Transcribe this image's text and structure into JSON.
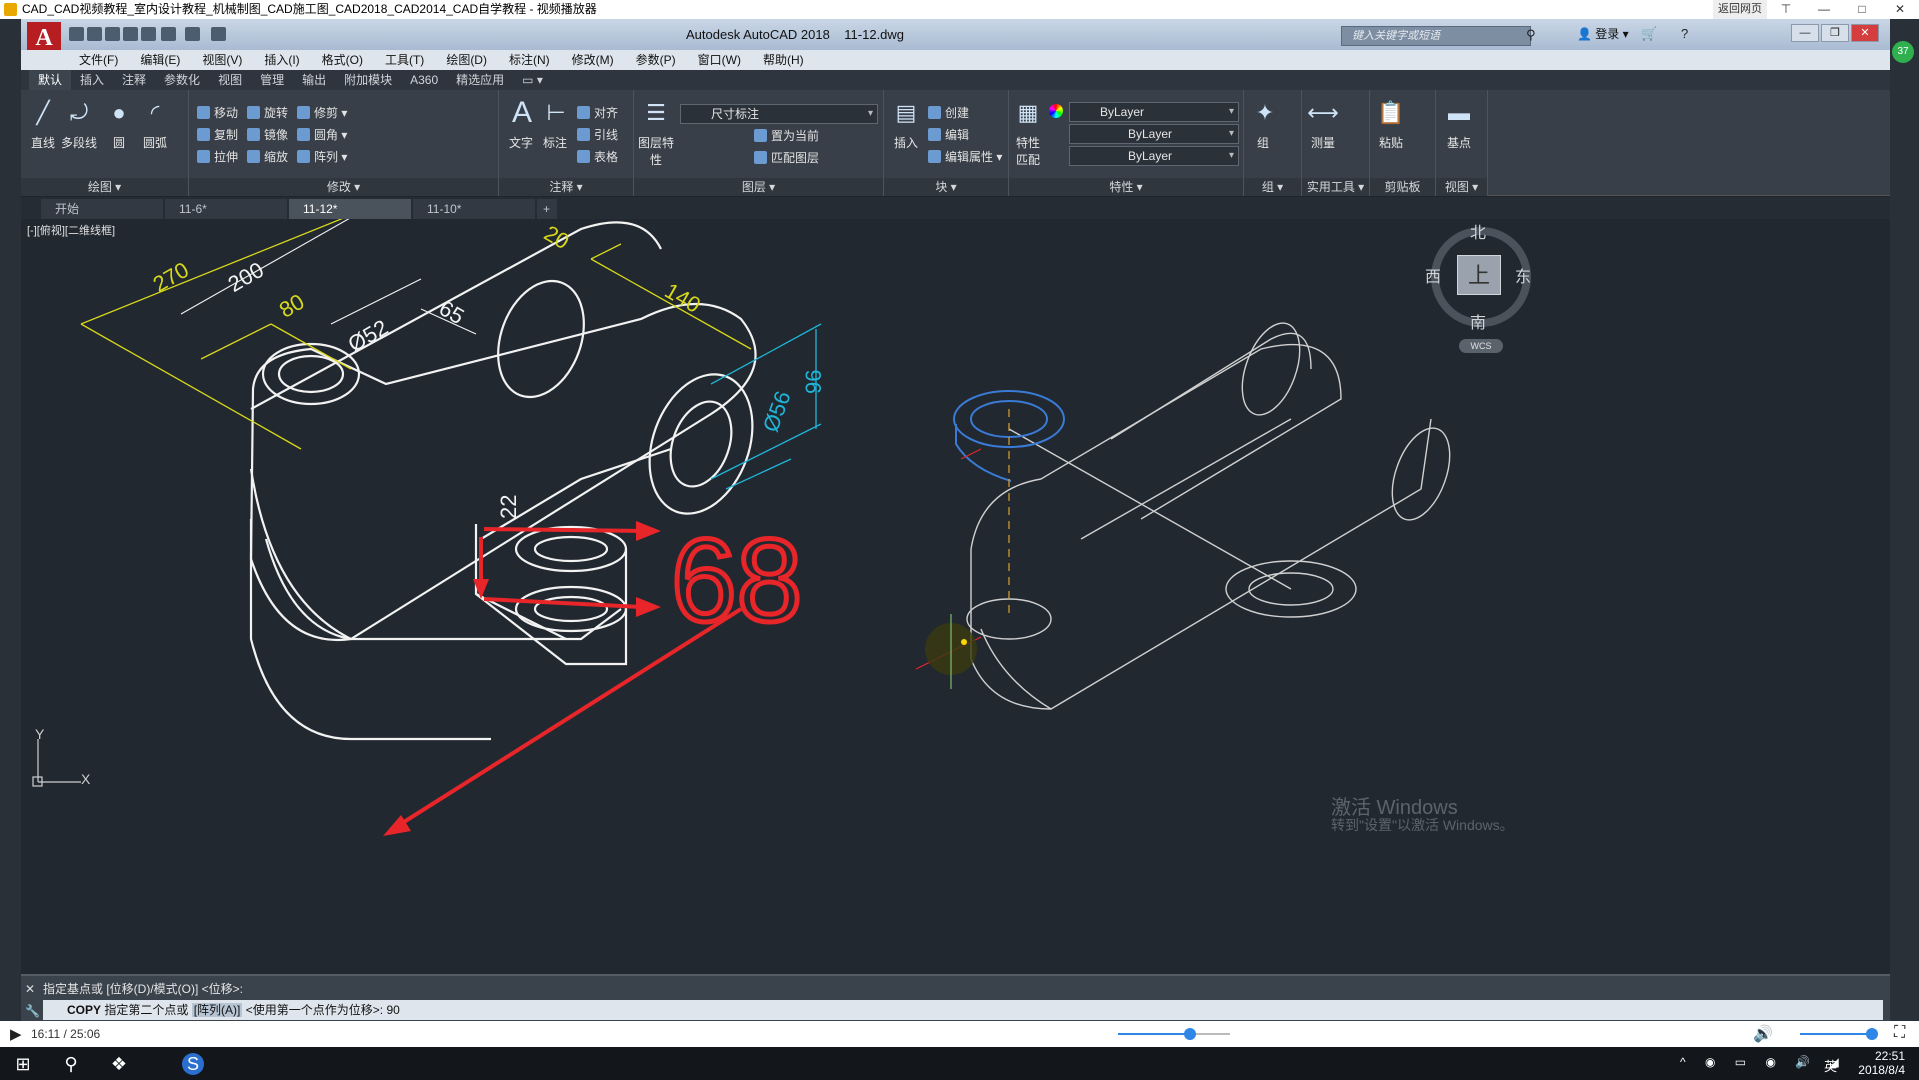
{
  "player": {
    "title": "CAD_CAD视频教程_室内设计教程_机械制图_CAD施工图_CAD2018_CAD2014_CAD自学教程 - 视频播放器",
    "return_label": "返回网页",
    "time": "16:11 / 25:06",
    "progress": 0.645
  },
  "app": {
    "logo": "A",
    "title": "Autodesk AutoCAD 2018",
    "file": "11-12.dwg",
    "search_placeholder": "键入关键字或短语",
    "login": "登录"
  },
  "menu": [
    "文件(F)",
    "编辑(E)",
    "视图(V)",
    "插入(I)",
    "格式(O)",
    "工具(T)",
    "绘图(D)",
    "标注(N)",
    "修改(M)",
    "参数(P)",
    "窗口(W)",
    "帮助(H)"
  ],
  "ribbon_tabs": [
    "默认",
    "插入",
    "注释",
    "参数化",
    "视图",
    "管理",
    "输出",
    "附加模块",
    "A360",
    "精选应用"
  ],
  "ribbon": {
    "draw": {
      "title": "绘图 ▾",
      "line": "直线",
      "polyline": "多段线",
      "circle": "圆",
      "arc": "圆弧"
    },
    "modify": {
      "title": "修改 ▾",
      "move": "移动",
      "rotate": "旋转",
      "trim": "修剪",
      "copy": "复制",
      "mirror": "镜像",
      "fillet": "圆角",
      "stretch": "拉伸",
      "scale": "缩放",
      "array": "阵列"
    },
    "annotation": {
      "title": "注释 ▾",
      "text": "文字",
      "dimension": "标注",
      "align": "对齐",
      "leader": "引线",
      "table": "表格"
    },
    "layers": {
      "title": "图层 ▾",
      "props": "图层特性",
      "current": "尺寸标注",
      "set_current": "置为当前",
      "match": "匹配图层"
    },
    "block": {
      "title": "块 ▾",
      "insert": "插入",
      "create": "创建",
      "edit": "编辑",
      "edit_attr": "编辑属性"
    },
    "properties": {
      "title": "特性 ▾",
      "match": "特性匹配",
      "color": "ByLayer",
      "linetype": "ByLayer",
      "lineweight": "ByLayer"
    },
    "groups": {
      "title": "组 ▾",
      "group": "组"
    },
    "utilities": {
      "title": "实用工具 ▾",
      "measure": "测量"
    },
    "clipboard": {
      "title": "剪贴板",
      "paste": "粘贴"
    },
    "view": {
      "title": "视图 ▾",
      "base": "基点"
    }
  },
  "doc_tabs": [
    "开始",
    "11-6*",
    "11-12*",
    "11-10*"
  ],
  "viewport_label": "[-][俯视][二维线框]",
  "viewcube": {
    "north": "北",
    "south": "南",
    "east": "东",
    "west": "西",
    "top": "上",
    "wcs": "WCS"
  },
  "ucs": {
    "x": "X",
    "y": "Y"
  },
  "dims": [
    "270",
    "200",
    "80",
    "Ø52",
    "65",
    "20",
    "140",
    "Ø56",
    "96",
    "22"
  ],
  "annotation_number": "68",
  "command": {
    "history": "指定基点或 [位移(D)/模式(O)] <位移>:",
    "name": "COPY",
    "prompt": "指定第二个点或",
    "keyword": "[阵列(A)]",
    "prompt2": "<使用第一个点作为位移>:",
    "value": "90"
  },
  "watermark": {
    "line1": "激活 Windows",
    "line2": "转到\"设置\"以激活 Windows。"
  },
  "taskbar": {
    "time": "22:51",
    "date": "2018/8/4",
    "lang": "英"
  },
  "colors": {
    "accent_red": "#e8262a",
    "dim_yellow": "#d8d81a",
    "dim_cyan": "#1fb5d8",
    "select_blue": "#3a7bd5"
  }
}
